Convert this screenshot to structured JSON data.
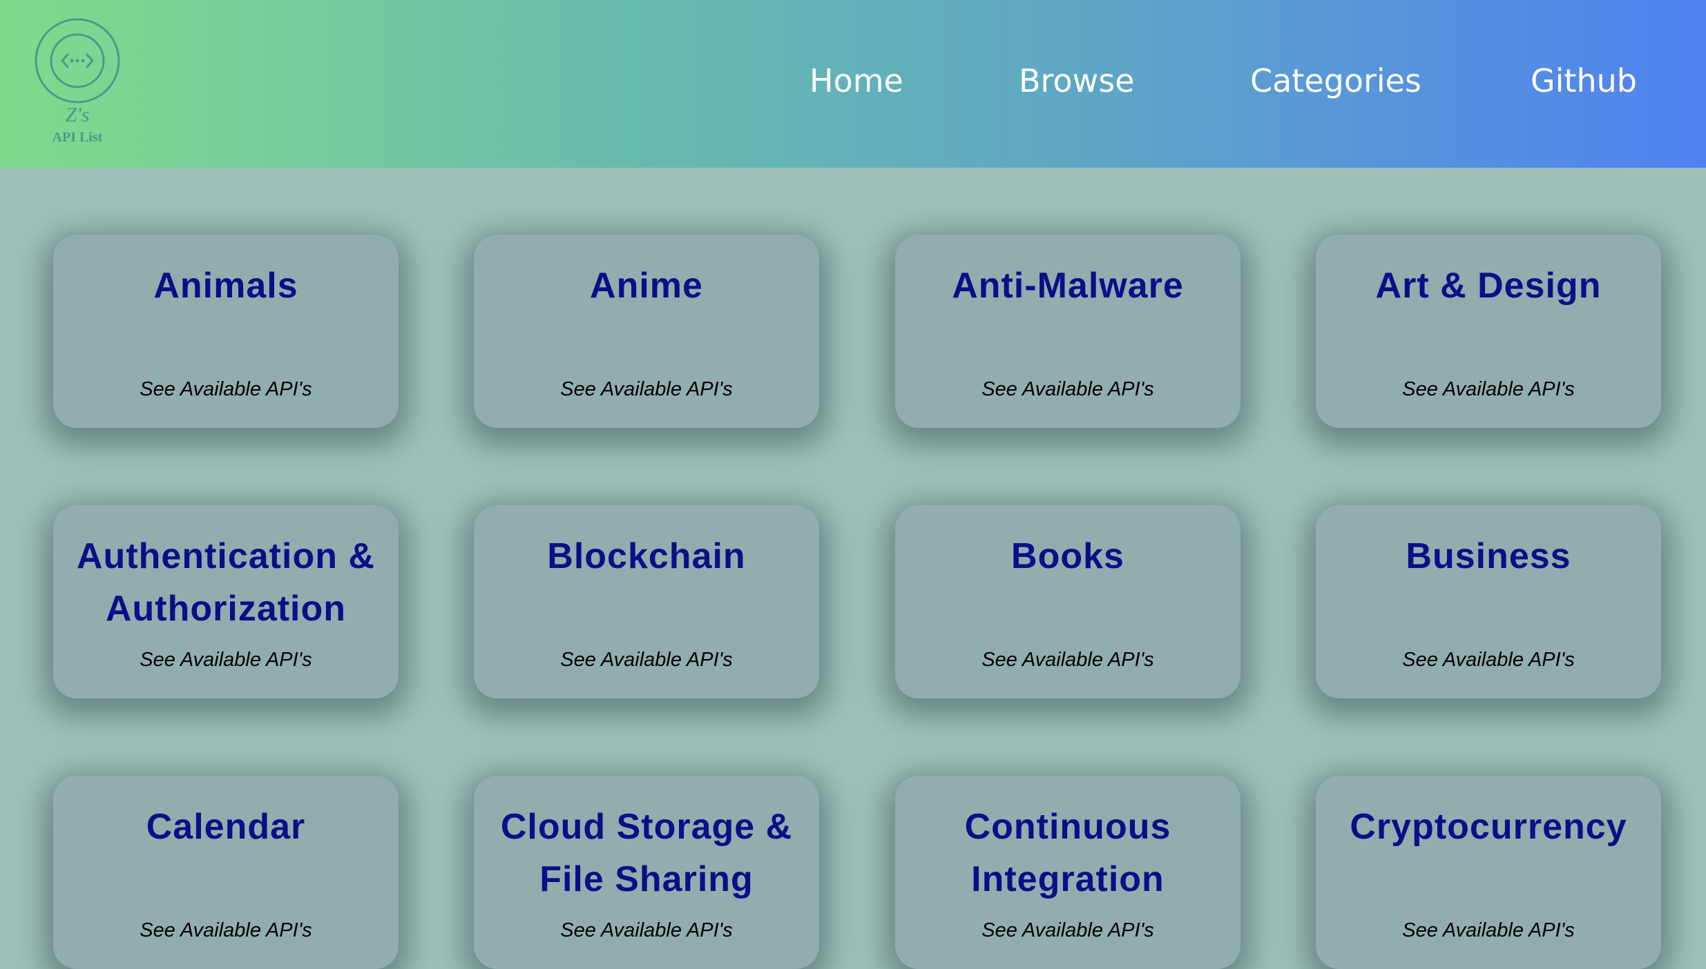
{
  "logo": {
    "line1": "Z's",
    "line2": "API List",
    "icon": "code-brackets-icon",
    "color": "#4a9a8a"
  },
  "nav": {
    "home": "Home",
    "browse": "Browse",
    "categories": "Categories",
    "github": "Github"
  },
  "colors": {
    "header_gradient": [
      "#7ddc8b",
      "#66bbae",
      "#5fa8c4",
      "#4f82f0"
    ],
    "background": "#9fc0bb",
    "card": "#92adae",
    "card_title": "#0a0f88"
  },
  "categories": [
    {
      "title": "Animals",
      "link": "See Available API's"
    },
    {
      "title": "Anime",
      "link": "See Available API's"
    },
    {
      "title": "Anti-Malware",
      "link": "See Available API's"
    },
    {
      "title": "Art & Design",
      "link": "See Available API's"
    },
    {
      "title": "Authentication & Authorization",
      "link": "See Available API's"
    },
    {
      "title": "Blockchain",
      "link": "See Available API's"
    },
    {
      "title": "Books",
      "link": "See Available API's"
    },
    {
      "title": "Business",
      "link": "See Available API's"
    },
    {
      "title": "Calendar",
      "link": "See Available API's"
    },
    {
      "title": "Cloud Storage & File Sharing",
      "link": "See Available API's"
    },
    {
      "title": "Continuous Integration",
      "link": "See Available API's"
    },
    {
      "title": "Cryptocurrency",
      "link": "See Available API's"
    }
  ]
}
